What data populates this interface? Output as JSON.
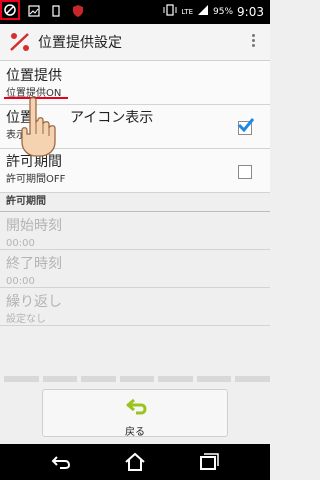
{
  "status_bar": {
    "lte": "LTE",
    "battery": "95%",
    "time": "9:03"
  },
  "action_bar": {
    "title": "位置提供設定",
    "app_icon": "location-share-icon",
    "overflow_icon": "overflow-menu-icon"
  },
  "settings": {
    "location": {
      "title": "位置提供",
      "summary": "位置提供ON"
    },
    "show_icon": {
      "title": "位置提供アイコン表示",
      "title_visible_prefix": "位置",
      "title_visible_suffix": "アイコン表示",
      "summary": "表示",
      "checked": true
    },
    "permit_period": {
      "title": "許可期間",
      "summary": "許可期間OFF",
      "checked": false
    },
    "section_header": "許可期間",
    "start_time": {
      "title": "開始時刻",
      "summary": "00:00"
    },
    "end_time": {
      "title": "終了時刻",
      "summary": "00:00"
    },
    "repeat": {
      "title": "繰り返し",
      "summary": "設定なし"
    }
  },
  "back_button": {
    "label": "戻る",
    "icon": "return-arrow-icon"
  },
  "nav_bar": {
    "back": "back-icon",
    "home": "home-icon",
    "recents": "recent-apps-icon"
  },
  "colors": {
    "accent": "#e8001c",
    "check": "#1e88e5",
    "back_arrow": "#9bc31e"
  }
}
